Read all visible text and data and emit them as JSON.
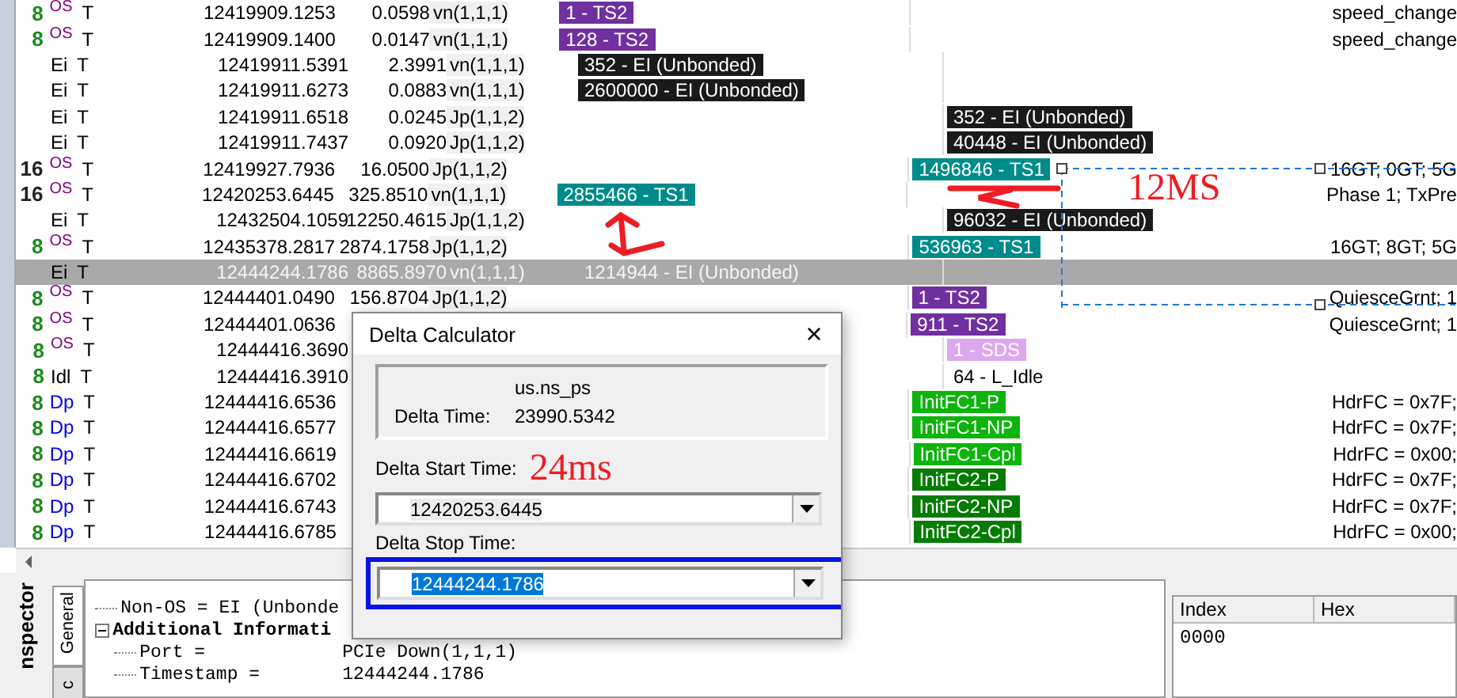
{
  "trace": {
    "rows": [
      {
        "count": {
          "text": "8",
          "color": "#1e8a1e"
        },
        "type": {
          "text": "OS",
          "color": "#800080"
        },
        "flag": "T",
        "time": "12419909.1253",
        "delta": "0.0598",
        "link": "vn(1,1,1)",
        "lane_a": {
          "text": "1 - TS2",
          "color": "#7030a0"
        },
        "info": "speed_change",
        "selected": false
      },
      {
        "count": {
          "text": "8",
          "color": "#1e8a1e"
        },
        "type": {
          "text": "OS",
          "color": "#800080"
        },
        "flag": "T",
        "time": "12419909.1400",
        "delta": "0.0147",
        "link": "vn(1,1,1)",
        "lane_a": {
          "text": "128 - TS2",
          "color": "#7030a0"
        },
        "info": "speed_change",
        "selected": false
      },
      {
        "type": {
          "text": "Ei",
          "color": "#000000"
        },
        "flag": "T",
        "time": "12419911.5391",
        "delta": "2.3991",
        "link": "vn(1,1,1)",
        "lane_a": {
          "text": "352 - EI (Unbonded)",
          "color": "#1a1a1a"
        },
        "selected": false
      },
      {
        "type": {
          "text": "Ei",
          "color": "#000000"
        },
        "flag": "T",
        "time": "12419911.6273",
        "delta": "0.0883",
        "link": "vn(1,1,1)",
        "lane_a": {
          "text": "2600000 - EI (Unbonded)",
          "color": "#1a1a1a"
        },
        "selected": false
      },
      {
        "type": {
          "text": "Ei",
          "color": "#000000"
        },
        "flag": "T",
        "time": "12419911.6518",
        "delta": "0.0245",
        "link": "Jp(1,1,2)",
        "lane_b": {
          "text": "352 - EI (Unbonded)",
          "color": "#1a1a1a"
        },
        "selected": false
      },
      {
        "type": {
          "text": "Ei",
          "color": "#000000"
        },
        "flag": "T",
        "time": "12419911.7437",
        "delta": "0.0920",
        "link": "Jp(1,1,2)",
        "lane_b": {
          "text": "40448 - EI (Unbonded)",
          "color": "#1a1a1a"
        },
        "selected": false
      },
      {
        "count": {
          "text": "16",
          "color": "#222222"
        },
        "type": {
          "text": "OS",
          "color": "#800080"
        },
        "flag": "T",
        "time": "12419927.7936",
        "delta": "16.0500",
        "link": "Jp(1,1,2)",
        "lane_b": {
          "text": "1496846 - TS1",
          "color": "#008b8b"
        },
        "info": "16GT; 0GT; 5G",
        "selected": false
      },
      {
        "count": {
          "text": "16",
          "color": "#222222"
        },
        "type": {
          "text": "OS",
          "color": "#800080"
        },
        "flag": "T",
        "time": "12420253.6445",
        "delta": "325.8510",
        "link": "vn(1,1,1)",
        "lane_a": {
          "text": "2855466 - TS1",
          "color": "#008b8b"
        },
        "info": "Phase 1; TxPre",
        "selected": false
      },
      {
        "type": {
          "text": "Ei",
          "color": "#000000"
        },
        "flag": "T",
        "time": "12432504.1059",
        "delta": "12250.4615",
        "link": "Jp(1,1,2)",
        "lane_b": {
          "text": "96032 - EI (Unbonded)",
          "color": "#1a1a1a"
        },
        "selected": false
      },
      {
        "count": {
          "text": "8",
          "color": "#1e8a1e"
        },
        "type": {
          "text": "OS",
          "color": "#800080"
        },
        "flag": "T",
        "time": "12435378.2817",
        "delta": "2874.1758",
        "link": "Jp(1,1,2)",
        "lane_b": {
          "text": "536963 - TS1",
          "color": "#008b8b"
        },
        "info": "16GT; 8GT; 5G",
        "selected": false
      },
      {
        "type": {
          "text": "Ei",
          "color": "#000000"
        },
        "flag": "T",
        "time": "12444244.1786",
        "delta": "8865.8970",
        "link": "vn(1,1,1)",
        "lane_a": {
          "text": "1214944 - EI (Unbonded)"
        },
        "selected": true
      },
      {
        "count": {
          "text": "8",
          "color": "#1e8a1e"
        },
        "type": {
          "text": "OS",
          "color": "#800080"
        },
        "flag": "T",
        "time": "12444401.0490",
        "delta": "156.8704",
        "link": "Jp(1,1,2)",
        "lane_b": {
          "text": "1 - TS2",
          "color": "#7030a0"
        },
        "info": "QuiesceGrnt; 1",
        "selected": false
      },
      {
        "count": {
          "text": "8",
          "color": "#1e8a1e"
        },
        "type": {
          "text": "OS",
          "color": "#800080"
        },
        "flag": "T",
        "time": "12444401.0636",
        "lane_b": {
          "text": "911 - TS2",
          "color": "#7030a0"
        },
        "info": "QuiesceGrnt; 1",
        "selected": false
      },
      {
        "count": {
          "text": "8",
          "color": "#1e8a1e"
        },
        "type": {
          "text": "OS",
          "color": "#800080"
        },
        "flag": "T",
        "time": "12444416.3690",
        "lane_b": {
          "text": "1 - SDS",
          "color": "#dda8f0"
        },
        "selected": false
      },
      {
        "count": {
          "text": "8",
          "color": "#1e8a1e"
        },
        "type": {
          "text": "Idl",
          "color": "#000000"
        },
        "flag": "T",
        "time": "12444416.3910",
        "lane_b": {
          "text": "64 - L_Idle"
        },
        "selected": false
      },
      {
        "count": {
          "text": "8",
          "color": "#1e8a1e"
        },
        "type": {
          "text": "Dp",
          "color": "#0000ee"
        },
        "flag": "T",
        "time": "12444416.6536",
        "lane_b": {
          "text": "InitFC1-P",
          "color": "#0cb40c"
        },
        "info": "HdrFC = 0x7F;",
        "selected": false
      },
      {
        "count": {
          "text": "8",
          "color": "#1e8a1e"
        },
        "type": {
          "text": "Dp",
          "color": "#0000ee"
        },
        "flag": "T",
        "time": "12444416.6577",
        "lane_b": {
          "text": "InitFC1-NP",
          "color": "#0cb40c"
        },
        "info": "HdrFC = 0x7F;",
        "selected": false
      },
      {
        "count": {
          "text": "8",
          "color": "#1e8a1e"
        },
        "type": {
          "text": "Dp",
          "color": "#0000ee"
        },
        "flag": "T",
        "time": "12444416.6619",
        "lane_b": {
          "text": "InitFC1-Cpl",
          "color": "#0cb40c"
        },
        "info": "HdrFC = 0x00;",
        "selected": false
      },
      {
        "count": {
          "text": "8",
          "color": "#1e8a1e"
        },
        "type": {
          "text": "Dp",
          "color": "#0000ee"
        },
        "flag": "T",
        "time": "12444416.6702",
        "lane_b": {
          "text": "InitFC2-P",
          "color": "#067c06"
        },
        "info": "HdrFC = 0x7F;",
        "selected": false
      },
      {
        "count": {
          "text": "8",
          "color": "#1e8a1e"
        },
        "type": {
          "text": "Dp",
          "color": "#0000ee"
        },
        "flag": "T",
        "time": "12444416.6743",
        "lane_b": {
          "text": "InitFC2-NP",
          "color": "#067c06"
        },
        "info": "HdrFC = 0x7F;",
        "selected": false
      },
      {
        "count": {
          "text": "8",
          "color": "#1e8a1e"
        },
        "type": {
          "text": "Dp",
          "color": "#0000ee"
        },
        "flag": "T",
        "time": "12444416.6785",
        "lane_b": {
          "text": "InitFC2-Cpl",
          "color": "#067c06"
        },
        "info": "HdrFC = 0x00;",
        "selected": false
      }
    ]
  },
  "annotations": {
    "gap_note": "12MS"
  },
  "inspector": {
    "side_label": "nspector",
    "tabs": [
      {
        "label": "General",
        "selected": true
      },
      {
        "label": "c",
        "selected": false
      }
    ],
    "tree": [
      {
        "label": "Non-OS = EI (Unbonde",
        "bold": false
      },
      {
        "label": "Additional Informati",
        "bold": true,
        "expanded": true,
        "children": [
          {
            "label": "Port =",
            "value": "PCIe Down(1,1,1)"
          },
          {
            "label": "Timestamp =",
            "value": "12444244.1786"
          }
        ]
      }
    ],
    "hex": {
      "columns": [
        "Index",
        "Hex"
      ],
      "rows": [
        [
          "0000"
        ]
      ]
    }
  },
  "dialog": {
    "title": "Delta Calculator",
    "close": "×",
    "unit": "us.ns_ps",
    "delta_label": "Delta Time:",
    "delta_value": "23990.5342",
    "start_label": "Delta Start Time:",
    "start_note": "24ms",
    "start_value": "12420253.6445",
    "stop_label": "Delta Stop Time:",
    "stop_value": "12444244.1786",
    "stop_focused": true
  }
}
